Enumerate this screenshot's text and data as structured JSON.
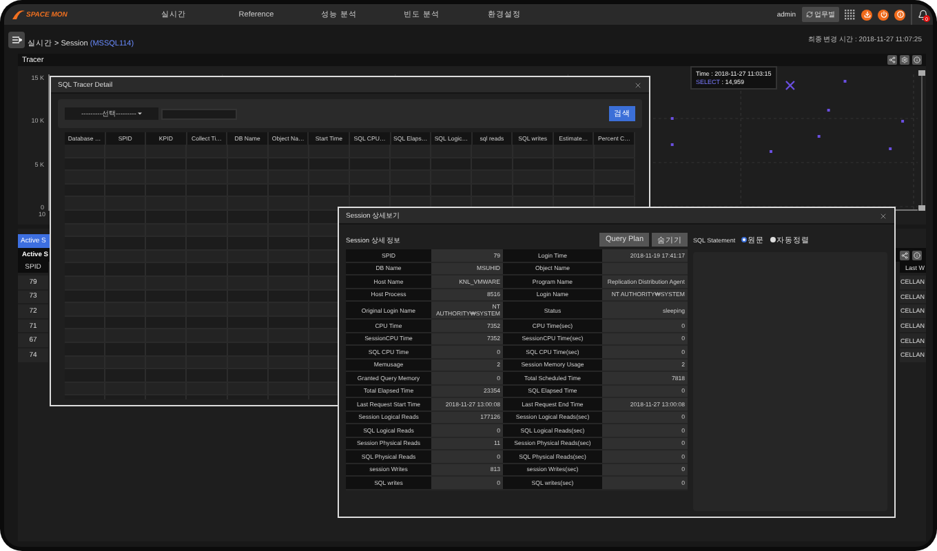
{
  "header": {
    "logo": "SPACE MON",
    "nav": [
      {
        "label": "실시간"
      },
      {
        "label": "Reference"
      },
      {
        "label": "성능 분석"
      },
      {
        "label": "빈도 분석"
      },
      {
        "label": "환경설정"
      }
    ],
    "user": "admin",
    "mode_button": "업무별",
    "notification_count": "0"
  },
  "breadcrumb": {
    "path": "실시간 > Session",
    "instance": "(MSSQL114)",
    "updated": "최종 변경 시간 : 2018-11-27 11:07:25"
  },
  "tracer": {
    "title": "Tracer",
    "y_ticks": [
      "15 K",
      "10 K",
      "5 K",
      "0"
    ],
    "x_tick": "10",
    "tooltip": [
      {
        "label": "Time",
        "value": ": 2018-11-27 11:03:15"
      },
      {
        "label": "SELECT",
        "value": ": 14,959"
      }
    ]
  },
  "active_sessions": {
    "tab": "Active S",
    "title": "Active S",
    "columns": [
      "SPID",
      "Last W"
    ],
    "rows": [
      {
        "spid": "79",
        "last_wait": "CELLAN"
      },
      {
        "spid": "73",
        "last_wait": "CELLAN"
      },
      {
        "spid": "72",
        "last_wait": "CELLAN"
      },
      {
        "spid": "71",
        "last_wait": "CELLAN"
      },
      {
        "spid": "67",
        "last_wait": "CELLAN"
      },
      {
        "spid": "74",
        "last_wait": "CELLAN"
      }
    ]
  },
  "sql_tracer_dialog": {
    "title": "SQL Tracer Detail",
    "select": "---------선택---------",
    "search_button": "검색",
    "columns": [
      "Database …",
      "SPID",
      "KPID",
      "Collect Ti…",
      "DB Name",
      "Object Na…",
      "Start Time",
      "SQL CPU…",
      "SQL Elaps…",
      "SQL Logic…",
      "sql reads",
      "SQL writes",
      "Estimate…",
      "Percent C…"
    ]
  },
  "session_dialog": {
    "title": "Session 상세보기",
    "section_title": "Session 상세 정보",
    "buttons": [
      "Query Plan",
      "숨기기"
    ],
    "statement_label": "SQL Statement",
    "statement_options": [
      {
        "label": "원문",
        "selected": true
      },
      {
        "label": "자동정렬",
        "selected": false
      }
    ],
    "rows": [
      [
        {
          "label": "SPID",
          "value": "79"
        },
        {
          "label": "Login Time",
          "value": "2018-11-19 17:41:17"
        }
      ],
      [
        {
          "label": "DB Name",
          "value": "MSUHID"
        },
        {
          "label": "Object Name"
        }
      ],
      [
        {
          "label": "Host Name",
          "value": "KNL_VMWARE"
        },
        {
          "label": "Program Name",
          "value": "Replication Distribution Agent"
        }
      ],
      [
        {
          "label": "Host Process",
          "value": "8516"
        },
        {
          "label": "Login Name",
          "value": "NT AUTHORITY₩SYSTEM"
        }
      ],
      [
        {
          "label": "Original Login Name",
          "value": "NT AUTHORITY₩SYSTEM"
        },
        {
          "label": "Status",
          "value": "sleeping"
        }
      ],
      [
        {
          "label": "CPU Time",
          "value": "7352"
        },
        {
          "label": "CPU Time(sec)",
          "value": "0"
        }
      ],
      [
        {
          "label": "SessionCPU Time",
          "value": "7352"
        },
        {
          "label": "SessionCPU Time(sec)",
          "value": "0"
        }
      ],
      [
        {
          "label": "SQL CPU Time",
          "value": "0"
        },
        {
          "label": "SQL CPU Time(sec)",
          "value": "0"
        }
      ],
      [
        {
          "label": "Memusage",
          "value": "2"
        },
        {
          "label": "Session Memory Usage",
          "value": "2"
        }
      ],
      [
        {
          "label": "Granted Query Memory",
          "value": "0"
        },
        {
          "label": "Total Scheduled Time",
          "value": "7818"
        }
      ],
      [
        {
          "label": "Total Elapsed Time",
          "value": "23354"
        },
        {
          "label": "SQL Elapsed Time",
          "value": "0"
        }
      ],
      [
        {
          "label": "Last Request Start Time",
          "value": "2018-11-27 13:00:08"
        },
        {
          "label": "Last Request End Time",
          "value": "2018-11-27 13:00:08"
        }
      ],
      [
        {
          "label": "Session Logical Reads",
          "value": "177126"
        },
        {
          "label": "Session Logical Reads(sec)",
          "value": "0"
        }
      ],
      [
        {
          "label": "SQL Logical Reads",
          "value": "0"
        },
        {
          "label": "SQL Logical Reads(sec)",
          "value": "0"
        }
      ],
      [
        {
          "label": "Session Physical Reads",
          "value": "11"
        },
        {
          "label": "Session Physical Reads(sec)",
          "value": "0"
        }
      ],
      [
        {
          "label": "SQL Physical Reads",
          "value": "0"
        },
        {
          "label": "SQL Physical Reads(sec)",
          "value": "0"
        }
      ],
      [
        {
          "label": "session Writes",
          "value": "813"
        },
        {
          "label": "session Writes(sec)",
          "value": "0"
        }
      ],
      [
        {
          "label": "SQL writes",
          "value": "0"
        },
        {
          "label": "SQL writes(sec)",
          "value": "0"
        }
      ]
    ]
  }
}
